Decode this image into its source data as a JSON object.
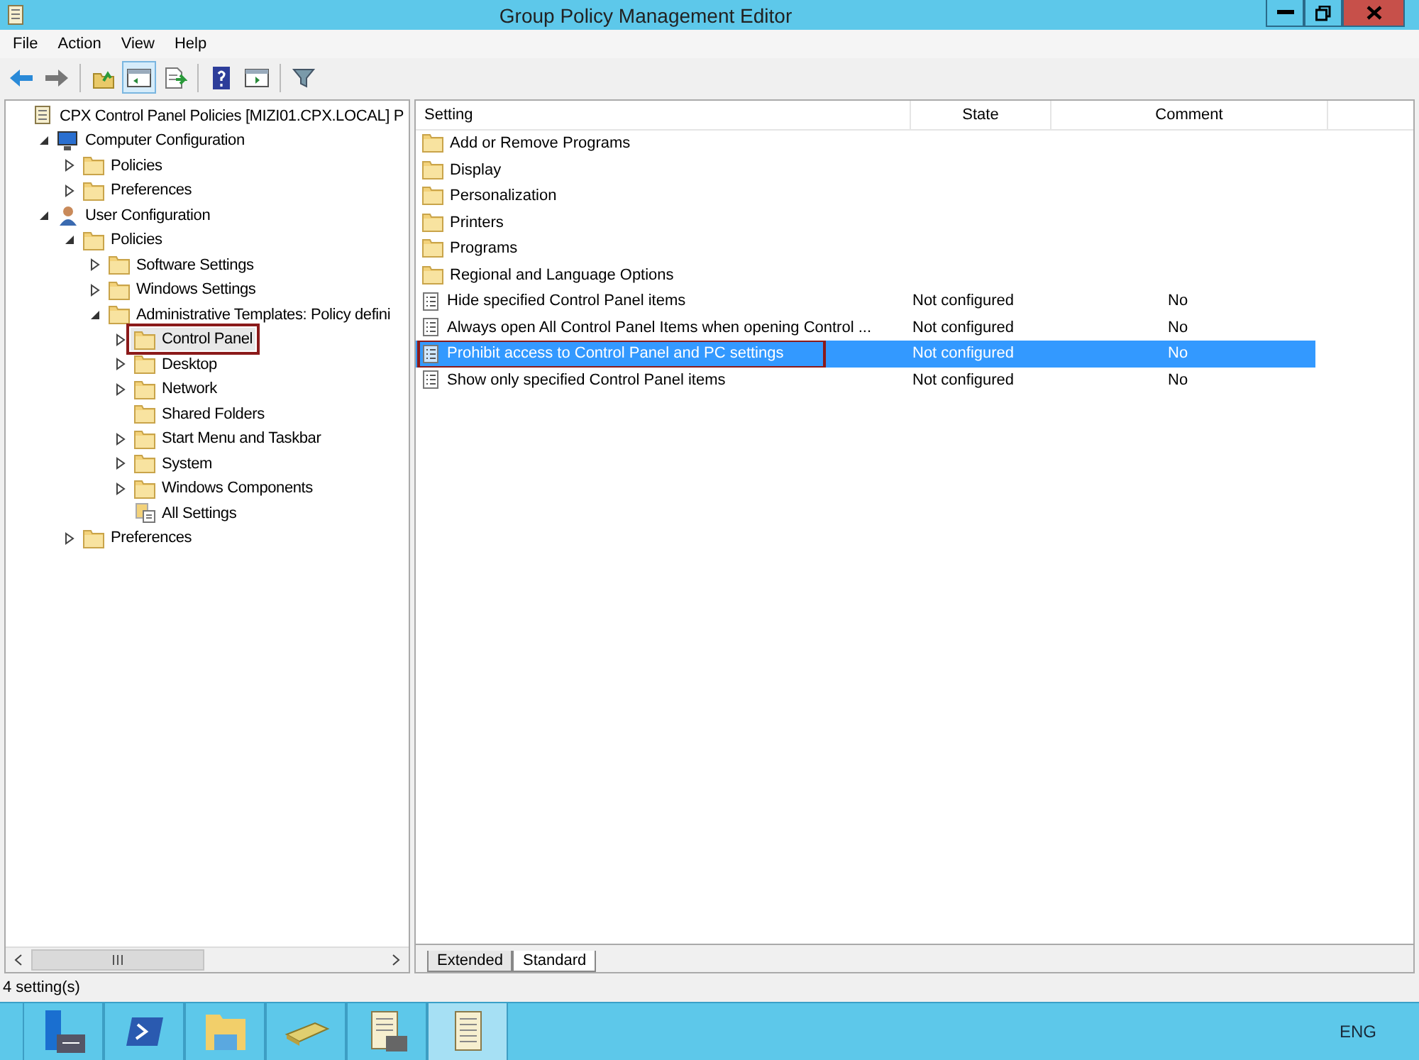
{
  "window": {
    "title": "Group Policy Management Editor"
  },
  "menu": [
    "File",
    "Action",
    "View",
    "Help"
  ],
  "toolbar": [
    {
      "kind": "back",
      "selected": false
    },
    {
      "kind": "forward",
      "selected": false
    },
    {
      "kind": "up",
      "selected": false
    },
    {
      "kind": "tree",
      "selected": true
    },
    {
      "kind": "export",
      "selected": false
    },
    {
      "kind": "help",
      "selected": false
    },
    {
      "kind": "pane",
      "selected": false
    },
    {
      "kind": "filter",
      "selected": false
    }
  ],
  "tree": {
    "items": [
      {
        "label": "CPX Control Panel Policies [MIZI01.CPX.LOCAL] P",
        "kind": "scroll",
        "selected": false,
        "outlined": false,
        "children": [
          {
            "label": "Computer Configuration",
            "kind": "computer",
            "expanded": true,
            "selected": false,
            "outlined": false,
            "children": [
              {
                "label": "Policies",
                "kind": "folder",
                "expanded": false,
                "selected": false,
                "outlined": false
              },
              {
                "label": "Preferences",
                "kind": "folder",
                "expanded": false,
                "selected": false,
                "outlined": false
              }
            ]
          },
          {
            "label": "User Configuration",
            "kind": "user",
            "expanded": true,
            "selected": false,
            "outlined": false,
            "children": [
              {
                "label": "Policies",
                "kind": "folder",
                "expanded": true,
                "selected": false,
                "outlined": false,
                "children": [
                  {
                    "label": "Software Settings",
                    "kind": "folder",
                    "expanded": false,
                    "selected": false,
                    "outlined": false
                  },
                  {
                    "label": "Windows Settings",
                    "kind": "folder",
                    "expanded": false,
                    "selected": false,
                    "outlined": false
                  },
                  {
                    "label": "Administrative Templates: Policy defini",
                    "kind": "folder",
                    "expanded": true,
                    "selected": false,
                    "outlined": false,
                    "children": [
                      {
                        "label": "Control Panel",
                        "kind": "folder",
                        "expanded": false,
                        "selected": true,
                        "outlined": true
                      },
                      {
                        "label": "Desktop",
                        "kind": "folder",
                        "expanded": false,
                        "selected": false,
                        "outlined": false
                      },
                      {
                        "label": "Network",
                        "kind": "folder",
                        "expanded": false,
                        "selected": false,
                        "outlined": false
                      },
                      {
                        "label": "Shared Folders",
                        "kind": "folder",
                        "selected": false,
                        "outlined": false
                      },
                      {
                        "label": "Start Menu and Taskbar",
                        "kind": "folder",
                        "expanded": false,
                        "selected": false,
                        "outlined": false
                      },
                      {
                        "label": "System",
                        "kind": "folder",
                        "expanded": false,
                        "selected": false,
                        "outlined": false
                      },
                      {
                        "label": "Windows Components",
                        "kind": "folder",
                        "expanded": false,
                        "selected": false,
                        "outlined": false
                      },
                      {
                        "label": "All Settings",
                        "kind": "settings",
                        "selected": false,
                        "outlined": false
                      }
                    ]
                  }
                ]
              },
              {
                "label": "Preferences",
                "kind": "folder",
                "expanded": false,
                "selected": false,
                "outlined": false
              }
            ]
          }
        ]
      }
    ]
  },
  "table": {
    "columns": [
      "Setting",
      "State",
      "Comment"
    ],
    "rows": [
      {
        "kind": "folder",
        "setting": "Add or Remove Programs",
        "selected": false,
        "outlined": false
      },
      {
        "kind": "folder",
        "setting": "Display",
        "selected": false,
        "outlined": false
      },
      {
        "kind": "folder",
        "setting": "Personalization",
        "selected": false,
        "outlined": false
      },
      {
        "kind": "folder",
        "setting": "Printers",
        "selected": false,
        "outlined": false
      },
      {
        "kind": "folder",
        "setting": "Programs",
        "selected": false,
        "outlined": false
      },
      {
        "kind": "folder",
        "setting": "Regional and Language Options",
        "selected": false,
        "outlined": false
      },
      {
        "kind": "setting",
        "setting": "Hide specified Control Panel items",
        "state": "Not configured",
        "comment": "No",
        "selected": false,
        "outlined": false
      },
      {
        "kind": "setting",
        "setting": "Always open All Control Panel Items when opening Control ...",
        "state": "Not configured",
        "comment": "No",
        "selected": false,
        "outlined": false
      },
      {
        "kind": "setting",
        "setting": "Prohibit access to Control Panel and PC settings",
        "state": "Not configured",
        "comment": "No",
        "selected": true,
        "outlined": true
      },
      {
        "kind": "setting",
        "setting": "Show only specified Control Panel items",
        "state": "Not configured",
        "comment": "No",
        "selected": false,
        "outlined": false
      }
    ]
  },
  "tabs": [
    {
      "label": "Extended",
      "selected": false
    },
    {
      "label": "Standard",
      "selected": true
    }
  ],
  "status_bar": "4 setting(s)",
  "taskbar": {
    "apps": [
      {
        "kind": "server",
        "selected": false
      },
      {
        "kind": "terminal",
        "selected": false
      },
      {
        "kind": "explorer",
        "selected": false
      },
      {
        "kind": "scanner",
        "selected": false
      },
      {
        "kind": "scroll-toolbox",
        "selected": false
      },
      {
        "kind": "scroll",
        "selected": true
      }
    ],
    "language": "ENG"
  }
}
